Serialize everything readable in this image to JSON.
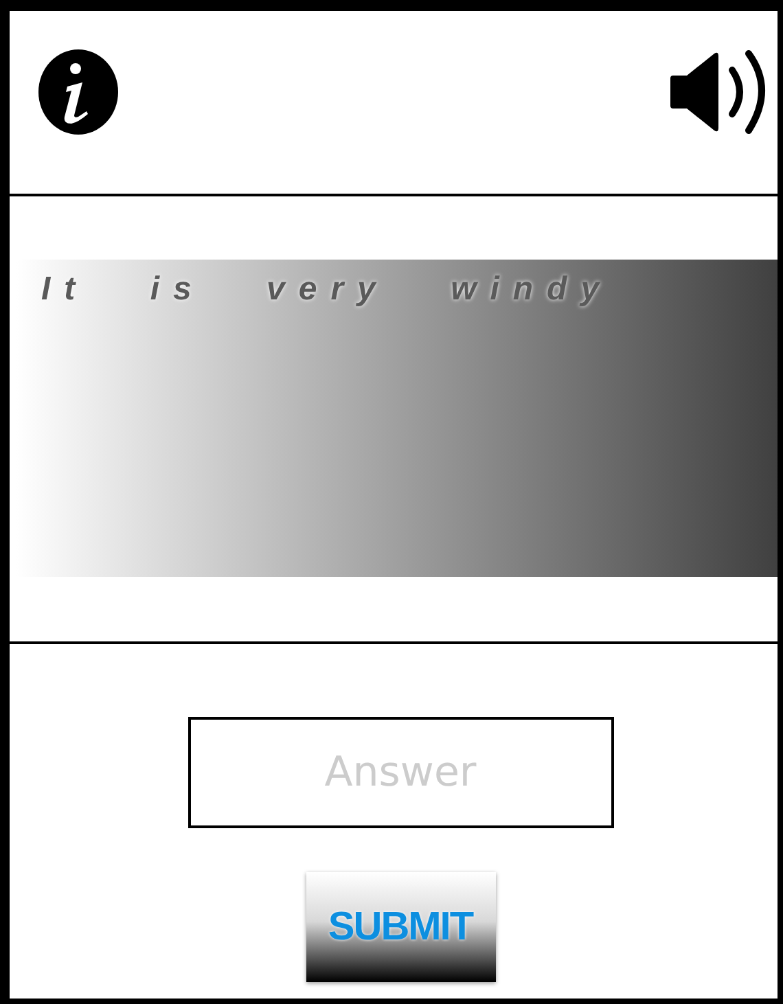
{
  "captcha": {
    "text": "It is very windy"
  },
  "answer": {
    "placeholder": "Answer"
  },
  "submit": {
    "label": "SUBMIT"
  }
}
